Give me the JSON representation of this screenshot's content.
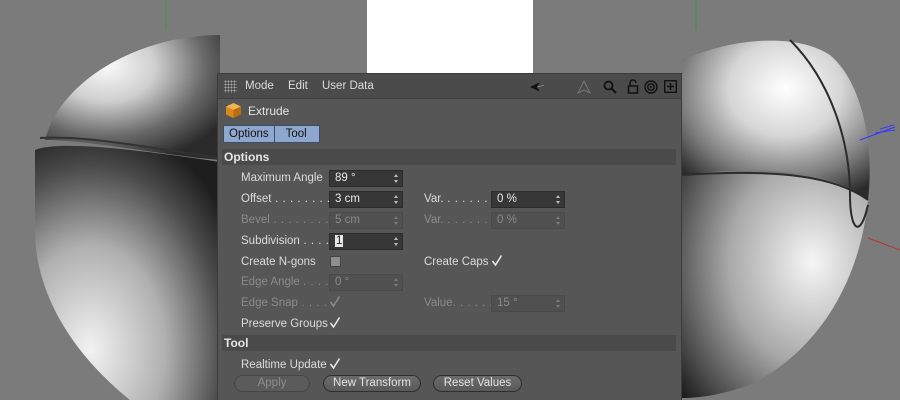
{
  "window": {
    "white_block_color": "#ffffff"
  },
  "menubar": {
    "items": [
      "Mode",
      "Edit",
      "User Data"
    ],
    "icons": [
      "back-arrow-icon",
      "up-arrow-icon",
      "search-icon",
      "lock-icon",
      "target-icon",
      "new-panel-icon"
    ]
  },
  "object": {
    "title": "Extrude",
    "icon": "extrude-cube-icon"
  },
  "tabs": [
    "Options",
    "Tool"
  ],
  "options": {
    "header": "Options",
    "maximum_angle": {
      "label": "Maximum Angle",
      "value": "89 °"
    },
    "offset": {
      "label": "Offset",
      "dots": " . . . . . . . . .",
      "value": "3 cm"
    },
    "offset_var": {
      "label": "Var.",
      "dots": " . . . . . . . . .",
      "value": "0 %"
    },
    "bevel": {
      "label": "Bevel",
      "dots": " . . . . . . . . .",
      "value": "5 cm"
    },
    "bevel_var": {
      "label": "Var.",
      "dots": " . . . . . . . . .",
      "value": "0 %"
    },
    "subdivision": {
      "label": "Subdivision",
      "dots": " . . . .",
      "value": "1"
    },
    "create_ngons": {
      "label": "Create N-gons",
      "checked": false
    },
    "create_caps": {
      "label": "Create Caps",
      "checked": true
    },
    "edge_angle": {
      "label": "Edge Angle",
      "dots": ". . . . .",
      "value": "0 °"
    },
    "edge_snap": {
      "label": "Edge Snap",
      "dots": " . . . . .",
      "checked": true
    },
    "value": {
      "label": "Value",
      "dots": ". . . . . .",
      "value": "15 °"
    },
    "preserve_groups": {
      "label": "Preserve Groups",
      "checked": true
    }
  },
  "tool": {
    "header": "Tool",
    "realtime_update": {
      "label": "Realtime Update",
      "checked": true
    },
    "apply_label": "Apply",
    "new_transform_label": "New Transform",
    "reset_values_label": "Reset Values"
  },
  "colors": {
    "tab_accent": "#8ea7cf",
    "panel_bg": "#565656",
    "viewport_bg": "#7b7b7b"
  }
}
